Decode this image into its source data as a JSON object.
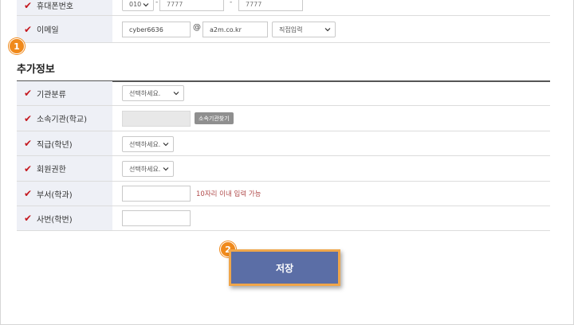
{
  "form": {
    "phone": {
      "label": "휴대폰번호",
      "prefix": "010",
      "middle": "7777",
      "last": "7777",
      "sep1": "-",
      "sep2": "-"
    },
    "email": {
      "label": "이메일",
      "local": "cyber6636",
      "at": "@",
      "domain": "a2m.co.kr",
      "domain_select": "직접입력"
    },
    "extra_section_title": "추가정보",
    "institution_type": {
      "label": "기관분류",
      "select": "선택하세요."
    },
    "institution": {
      "label": "소속기관(학교)",
      "value": "",
      "button": "소속기관찾기"
    },
    "rank": {
      "label": "직급(학년)",
      "select": "선택하세요."
    },
    "role": {
      "label": "회원권한",
      "select": "선택하세요."
    },
    "department": {
      "label": "부서(학과)",
      "value": "",
      "hint": "10자리 이내 입력 가능"
    },
    "employee_no": {
      "label": "사번(학번)",
      "value": ""
    },
    "check_icon": "check-icon"
  },
  "save_label": "저장",
  "annotations": {
    "one": "1",
    "two": "2"
  },
  "colors": {
    "label_bg": "#eef0f6",
    "check": "#c4171e",
    "badge": "#f08a1c",
    "save_bg": "#5b6ea6",
    "save_border": "#f0a64a",
    "hint": "#b04a4a"
  }
}
